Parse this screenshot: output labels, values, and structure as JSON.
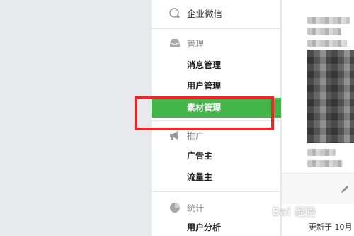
{
  "sidebar": {
    "wecom_label": "企业微信",
    "manage_label": "管理",
    "manage_items": [
      "消息管理",
      "用户管理",
      "素材管理"
    ],
    "promo_label": "推广",
    "promo_items": [
      "广告主",
      "流量主"
    ],
    "stats_label": "统计",
    "stats_items": [
      "用户分析"
    ],
    "active_item": "素材管理"
  },
  "content": {
    "update_text": "更新于 10月"
  },
  "watermark": "Bai 经验",
  "colors": {
    "active_bg": "#44b549",
    "annotation": "#ec2727"
  },
  "icons": [
    "wecom-icon",
    "inbox-icon",
    "megaphone-icon",
    "pie-chart-icon",
    "edit-pencil-icon"
  ]
}
